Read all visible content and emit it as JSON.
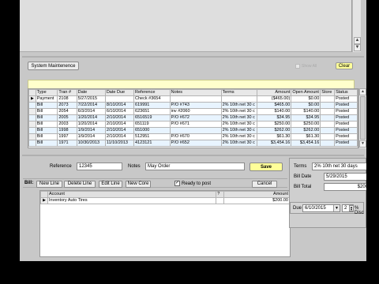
{
  "toolbar": {
    "system_maintenance": "System Maintenence",
    "show_all": "Show All",
    "clear": "Clear"
  },
  "grid": {
    "columns": [
      "Type",
      "Tran #",
      "Date",
      "Date Due",
      "Reference",
      "Notes",
      "Terms",
      "Amount",
      "Open Amount",
      "Store",
      "Status"
    ],
    "rows": [
      [
        "Payment",
        "2108",
        "5/27/2015",
        "",
        "Check #3654",
        "",
        "",
        "($465.00)",
        "$0.00",
        "",
        "Posted"
      ],
      [
        "Bill",
        "2073",
        "7/22/2014",
        "8/10/2014",
        "619991",
        "P/O #743",
        "2% 10th net 30 c",
        "$465.00",
        "$0.00",
        "",
        "Posted"
      ],
      [
        "Bill",
        "2054",
        "6/3/2014",
        "6/10/2014",
        "623651",
        "inv #2060",
        "2% 10th net 30 c",
        "$140.00",
        "$140.00",
        "",
        "Posted"
      ],
      [
        "Bill",
        "2005",
        "1/20/2014",
        "2/10/2014",
        "6516519",
        "P/O #672",
        "2% 10th net 30 c",
        "$34.95",
        "$34.95",
        "",
        "Posted"
      ],
      [
        "Bill",
        "2003",
        "1/20/2014",
        "2/10/2014",
        "651119",
        "P/O #671",
        "2% 10th net 30 c",
        "$250.00",
        "$250.00",
        "",
        "Posted"
      ],
      [
        "Bill",
        "1998",
        "1/9/2014",
        "2/10/2014",
        "651000",
        "",
        "2% 10th net 30 c",
        "$262.00",
        "$262.00",
        "",
        "Posted"
      ],
      [
        "Bill",
        "1997",
        "1/9/2014",
        "2/10/2014",
        "512951",
        "P/O #670",
        "2% 10th net 30 c",
        "$61.30",
        "$61.30",
        "",
        "Posted"
      ],
      [
        "Bill",
        "1971",
        "10/30/2013",
        "11/10/2013",
        "4123121",
        "P/O #652",
        "2% 10th net 30 c",
        "$3,454.16",
        "$3,454.16",
        "",
        "Posted"
      ]
    ]
  },
  "form": {
    "reference_label": "Reference",
    "reference_value": "12345",
    "notes_label": "Notes",
    "notes_value": "May Order",
    "save_label": "Save",
    "terms_label": "Terms",
    "terms_value": "2% 10th net 30 days",
    "bill_date_label": "Bill Date",
    "bill_date_value": "5/29/2015",
    "bill_total_label": "Bill Total",
    "bill_total_value": "$200",
    "due_label": "Due",
    "due_value": "6/10/2015",
    "disc_value": "2",
    "disc_label": "% Disc"
  },
  "bill_toolbar": {
    "bill_label": "Bill:",
    "new_line": "New Line",
    "delete_line": "Delete Line",
    "edit_line": "Edit Line",
    "new_core": "New Core",
    "ready_label": "Ready to post",
    "cancel": "Cancel"
  },
  "lines": {
    "columns": [
      "Account",
      "?",
      "Amount"
    ],
    "rows": [
      [
        "Inventory Auto Tires",
        "",
        "$200.00"
      ]
    ]
  },
  "colors": {
    "yellow_button": "#ffff99",
    "alt_row": "#e8f4ff"
  }
}
